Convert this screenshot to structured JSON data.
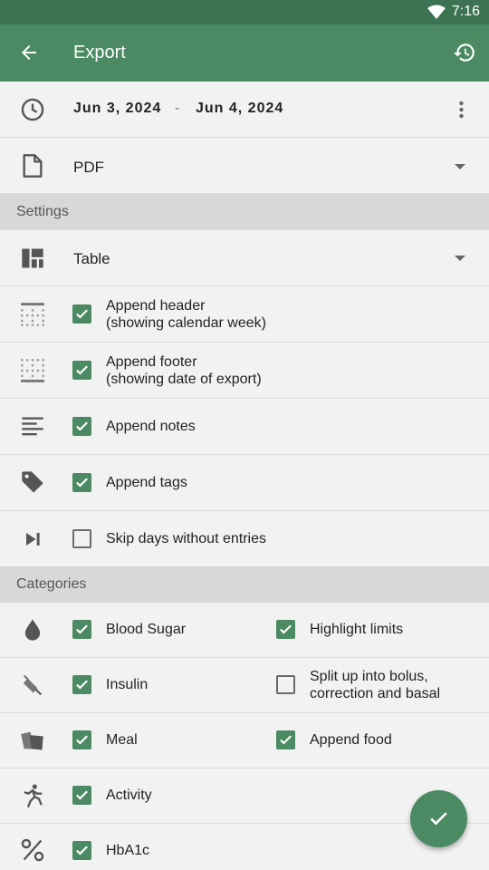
{
  "status_bar": {
    "time": "7:16"
  },
  "app_bar": {
    "title": "Export"
  },
  "date_range": {
    "from": "Jun 3, 2024",
    "separator": "-",
    "to": "Jun 4, 2024"
  },
  "format": {
    "value": "PDF"
  },
  "settings": {
    "header": "Settings",
    "layout": "Table",
    "options": [
      {
        "line1": "Append header",
        "line2": "(showing calendar week)",
        "checked": true
      },
      {
        "line1": "Append footer",
        "line2": "(showing date of export)",
        "checked": true
      },
      {
        "line1": "Append notes",
        "line2": "",
        "checked": true
      },
      {
        "line1": "Append tags",
        "line2": "",
        "checked": true
      },
      {
        "line1": "Skip days without entries",
        "line2": "",
        "checked": false
      }
    ]
  },
  "categories": {
    "header": "Categories",
    "items": [
      {
        "label": "Blood Sugar",
        "checked": true,
        "extra_line1": "Highlight limits",
        "extra_line2": "",
        "extra_checked": true
      },
      {
        "label": "Insulin",
        "checked": true,
        "extra_line1": "Split up into bolus,",
        "extra_line2": "correction and basal",
        "extra_checked": false
      },
      {
        "label": "Meal",
        "checked": true,
        "extra_line1": "Append food",
        "extra_line2": "",
        "extra_checked": true
      },
      {
        "label": "Activity",
        "checked": true
      },
      {
        "label": "HbA1c",
        "checked": true
      }
    ]
  },
  "colors": {
    "primary": "#4b8a62",
    "status_bar": "#3d7352",
    "section_bg": "#d8d8d8"
  }
}
